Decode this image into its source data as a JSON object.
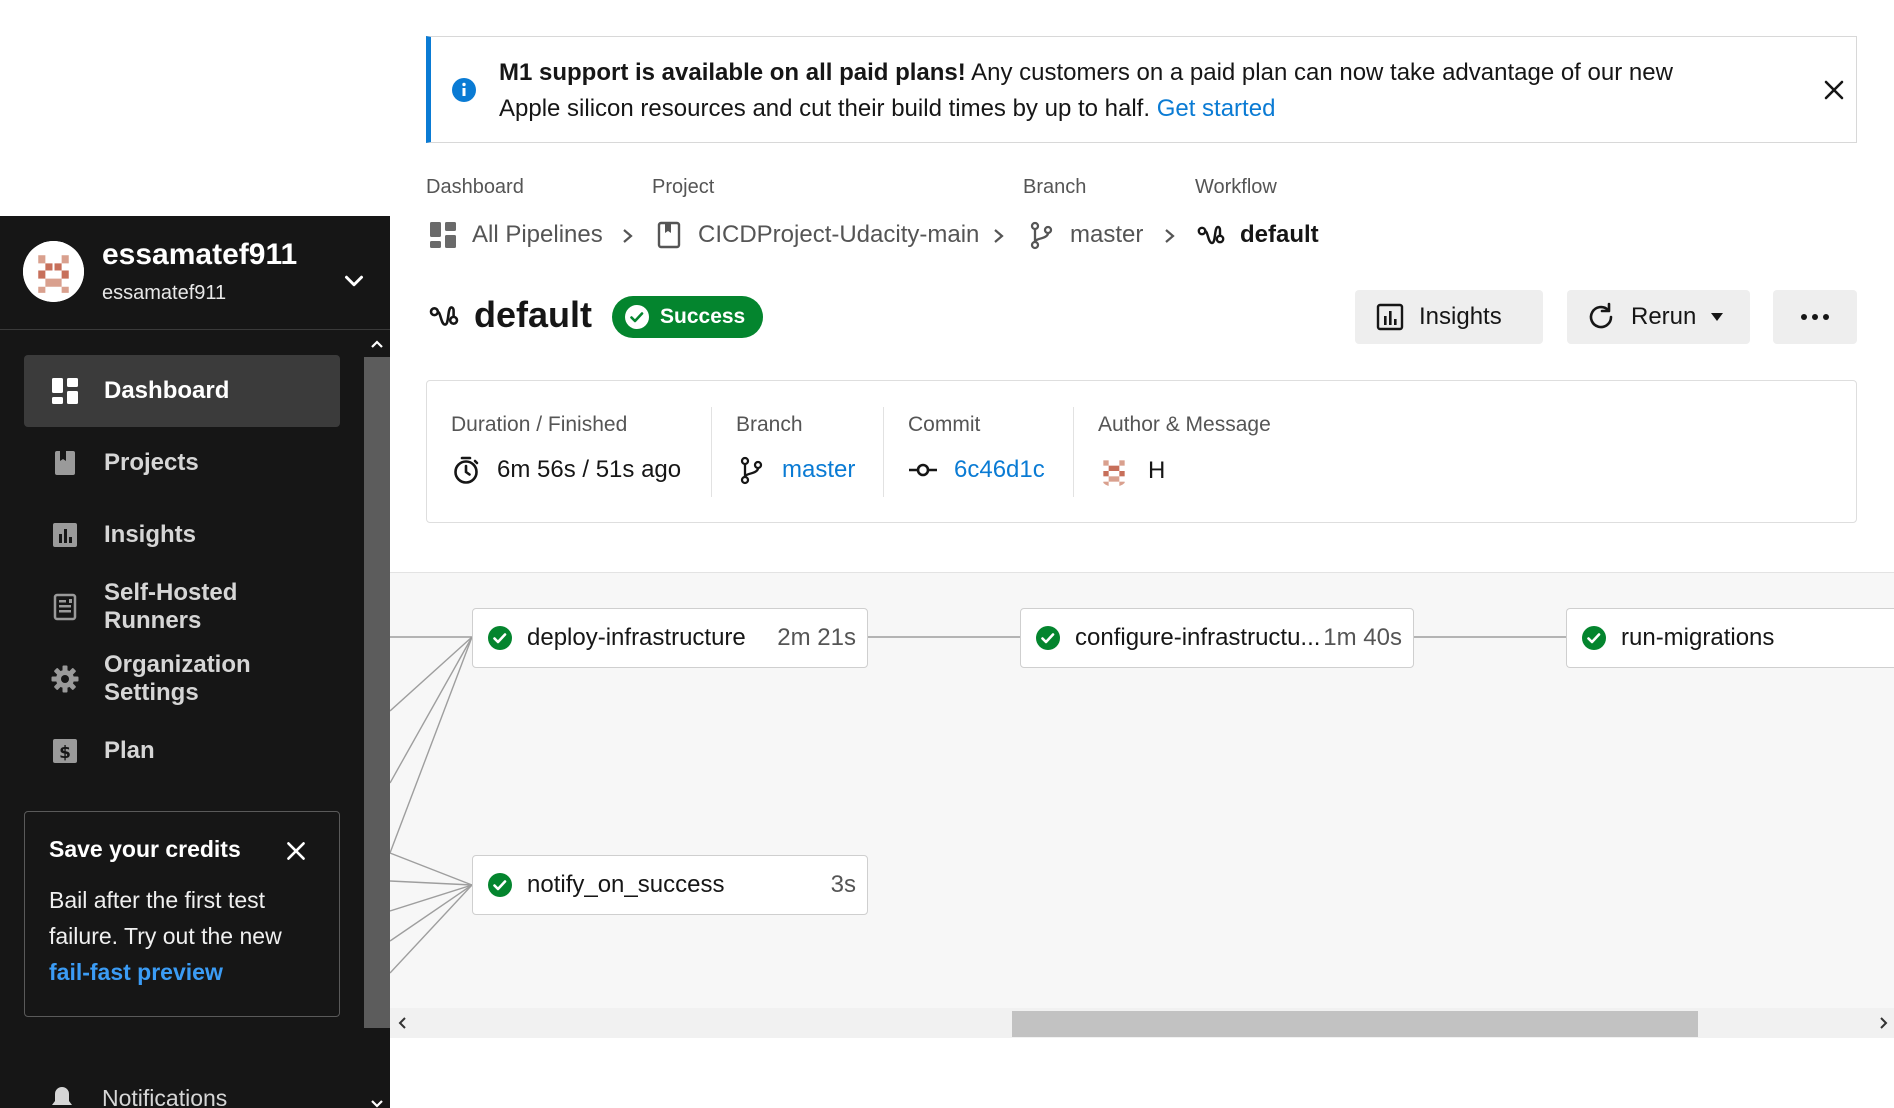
{
  "banner": {
    "bold": "M1 support is available on all paid plans!",
    "text": " Any customers on a paid plan can now take advantage of our new Apple silicon resources and cut their build times by up to half. ",
    "link": "Get started"
  },
  "breadcrumbs": [
    {
      "caption": "Dashboard",
      "label": "All Pipelines",
      "icon": "dashboard-icon"
    },
    {
      "caption": "Project",
      "label": "CICDProject-Udacity-main",
      "icon": "project-icon"
    },
    {
      "caption": "Branch",
      "label": "master",
      "icon": "branch-icon"
    },
    {
      "caption": "Workflow",
      "label": "default",
      "icon": "workflow-icon"
    }
  ],
  "header": {
    "title": "default",
    "status": "Success",
    "insights_label": "Insights",
    "rerun_label": "Rerun"
  },
  "info": {
    "duration_caption": "Duration / Finished",
    "duration_value": "6m 56s / 51s ago",
    "branch_caption": "Branch",
    "branch_value": "master",
    "commit_caption": "Commit",
    "commit_value": "6c46d1c",
    "author_caption": "Author & Message",
    "author_message": "H"
  },
  "sidebar": {
    "user_name": "essamatef911",
    "org_name": "essamatef911",
    "items": [
      {
        "label": "Dashboard",
        "icon": "dashboard-icon",
        "active": true
      },
      {
        "label": "Projects",
        "icon": "projects-icon"
      },
      {
        "label": "Insights",
        "icon": "insights-icon"
      },
      {
        "label": "Self-Hosted Runners",
        "icon": "runners-icon"
      },
      {
        "label": "Organization Settings",
        "icon": "gear-icon"
      },
      {
        "label": "Plan",
        "icon": "dollar-icon"
      }
    ],
    "credits": {
      "title": "Save your credits",
      "body": "Bail after the first test failure. Try out the new ",
      "link": "fail-fast preview"
    },
    "notifications": "Notifications"
  },
  "jobs": [
    {
      "name": "deploy-infrastructure",
      "duration": "2m 21s",
      "status": "success"
    },
    {
      "name": "configure-infrastructu...",
      "duration": "1m 40s",
      "status": "success"
    },
    {
      "name": "run-migrations",
      "duration": "",
      "status": "success"
    },
    {
      "name": "notify_on_success",
      "duration": "3s",
      "status": "success"
    }
  ],
  "colors": {
    "accent": "#0a7bd4",
    "success": "#04852e",
    "sidebar_bg": "#161616"
  }
}
